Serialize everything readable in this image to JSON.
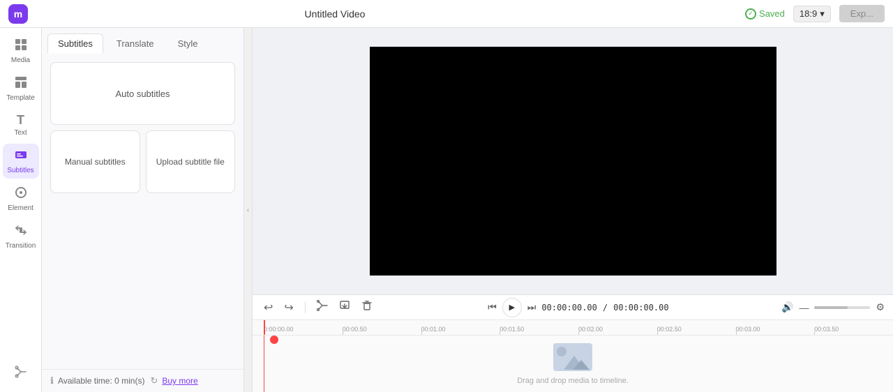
{
  "app": {
    "logo": "m",
    "title": "Untitled Video",
    "saved_label": "Saved",
    "aspect_ratio": "18:9",
    "export_label": "Exp..."
  },
  "sidebar": {
    "items": [
      {
        "id": "media",
        "label": "Media",
        "icon": "⊞"
      },
      {
        "id": "template",
        "label": "Template",
        "icon": "⊟"
      },
      {
        "id": "text",
        "label": "Text",
        "icon": "T"
      },
      {
        "id": "subtitles",
        "label": "Subtitles",
        "icon": "⊡",
        "active": true
      },
      {
        "id": "element",
        "label": "Element",
        "icon": "◉"
      },
      {
        "id": "transition",
        "label": "Transition",
        "icon": "⇌"
      }
    ],
    "bottom_icon": "✂"
  },
  "panel": {
    "tabs": [
      {
        "id": "subtitles",
        "label": "Subtitles",
        "active": true
      },
      {
        "id": "translate",
        "label": "Translate"
      },
      {
        "id": "style",
        "label": "Style"
      }
    ],
    "auto_subtitles_label": "Auto subtitles",
    "manual_subtitles_label": "Manual subtitles",
    "upload_subtitle_label": "Upload subtitle file",
    "footer_text": "Available time: 0 min(s)",
    "buy_more_label": "Buy more"
  },
  "preview": {
    "placeholder": "black screen"
  },
  "timeline": {
    "current_time": "00:00.00",
    "total_time": "00:00.00",
    "full_current": "00:00:00.00",
    "full_total": "00:00:00.00",
    "ruler_marks": [
      "0:00:00.00",
      "00:00.50",
      "00:01.00",
      "00:01.50",
      "00:02.00",
      "00:02.50",
      "00:03.00",
      "00:03.50"
    ],
    "drag_drop_text": "Drag and drop media to timeline.",
    "tools": {
      "undo_label": "↩",
      "redo_label": "↪",
      "cut_label": "✂",
      "import_label": "⬇",
      "delete_label": "🗑"
    }
  }
}
